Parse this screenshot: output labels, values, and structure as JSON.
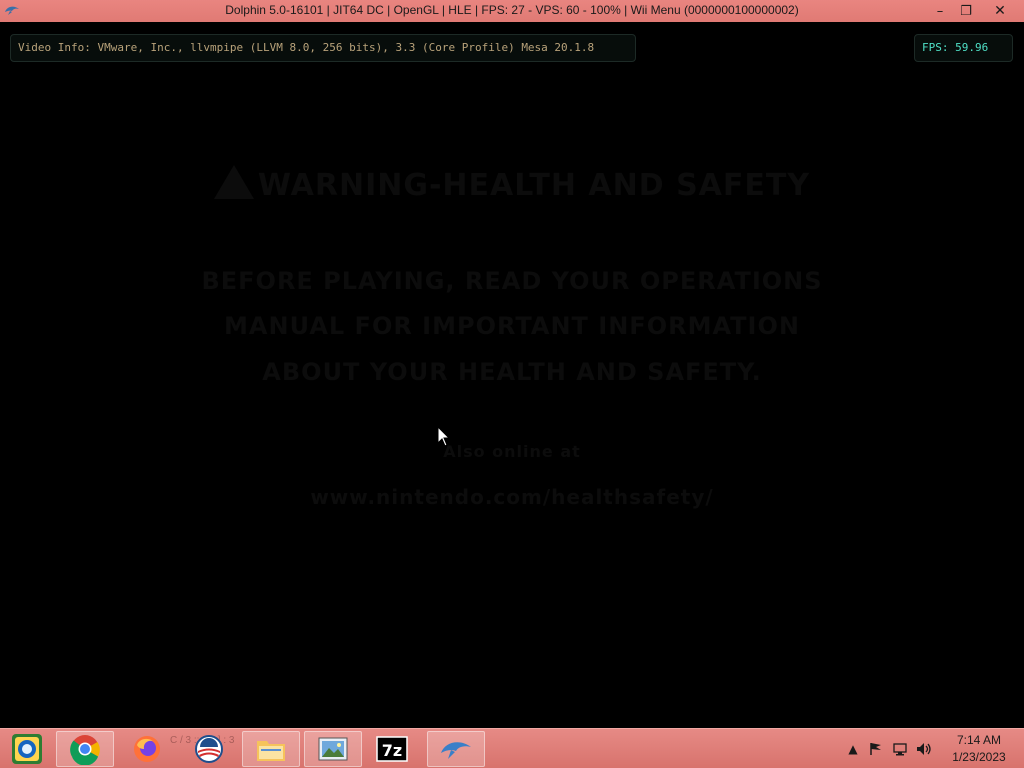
{
  "window": {
    "title": "Dolphin 5.0-16101 | JIT64 DC | OpenGL | HLE | FPS: 27 - VPS: 60 - 100% | Wii Menu (0000000100000002)",
    "minimize_glyph": "–",
    "maximize_glyph": "❐",
    "close_glyph": "✕"
  },
  "overlay": {
    "video_info": "Video Info: VMware, Inc., llvmpipe (LLVM 8.0, 256 bits), 3.3 (Core Profile) Mesa 20.1.8",
    "fps": "FPS: 59.96"
  },
  "screen": {
    "warning_title": "WARNING-HEALTH AND SAFETY",
    "line1": "BEFORE PLAYING, READ YOUR OPERATIONS",
    "line2": "MANUAL FOR IMPORTANT INFORMATION",
    "line3": "ABOUT YOUR HEALTH AND SAFETY.",
    "also_online": "Also online at",
    "url": "www.nintendo.com/healthsafety/"
  },
  "taskbar": {
    "items": [
      {
        "name": "start",
        "label": "Start"
      },
      {
        "name": "chrome",
        "label": "Google Chrome"
      },
      {
        "name": "firefox",
        "label": "Firefox"
      },
      {
        "name": "obama",
        "label": "Obama"
      },
      {
        "name": "explorer",
        "label": "File Explorer"
      },
      {
        "name": "photos",
        "label": "Photos"
      },
      {
        "name": "7zip",
        "label": "7z"
      },
      {
        "name": "dolphin",
        "label": "Dolphin"
      }
    ],
    "ghost_text": "C / 3  ::  ol[z]  :  3",
    "clock_time": "7:14 AM",
    "clock_date": "1/23/2023"
  },
  "colors": {
    "titlebar": "#e07a74",
    "taskbar": "#d8736d",
    "fps_text": "#4fe0c6",
    "video_info_text": "#b8a27a"
  }
}
